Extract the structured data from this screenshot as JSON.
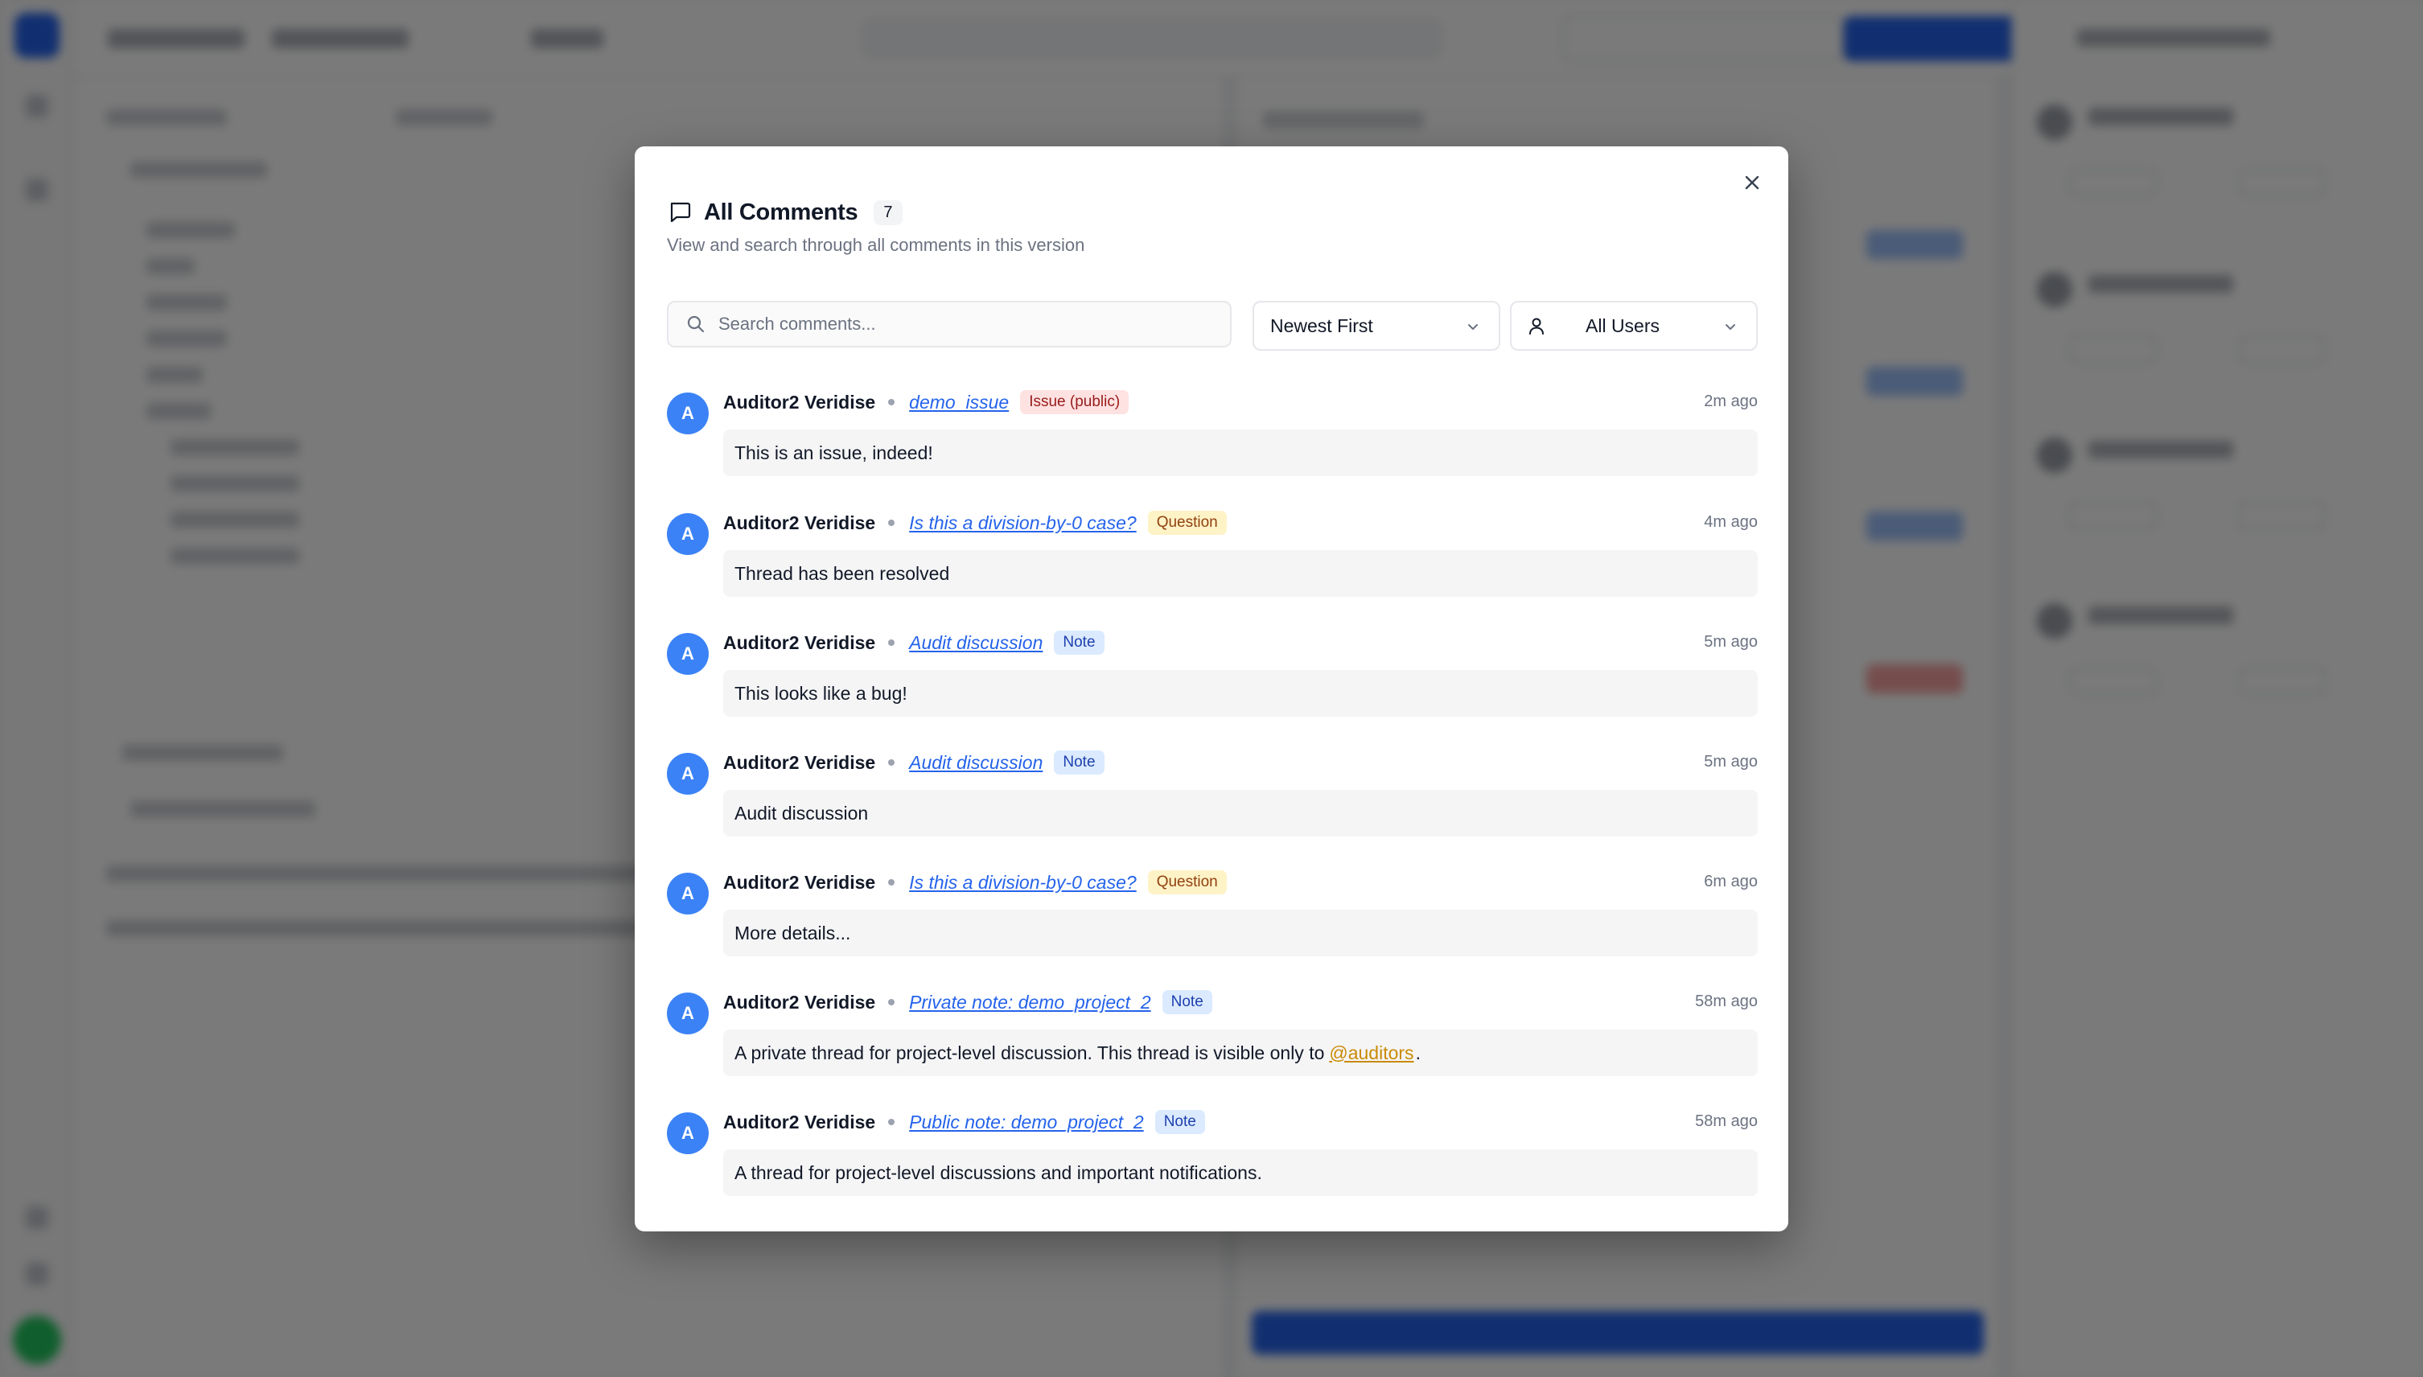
{
  "modal": {
    "title": "All Comments",
    "count": "7",
    "subtitle": "View and search through all comments in this version",
    "search_placeholder": "Search comments...",
    "sort_value": "Newest First",
    "user_filter_value": "All Users"
  },
  "icons": {
    "header": "chat-bubble-icon",
    "search": "search-icon",
    "user": "user-icon",
    "dropdown": "chevron-down-icon",
    "close": "close-icon"
  },
  "colors": {
    "accent": "#3b82f6",
    "link": "#2563eb",
    "issue_badge": "#fee2e2",
    "question_badge": "#fef3c7",
    "note_badge": "#dbeafe",
    "mention": "#ca8a04"
  },
  "comments": [
    {
      "initial": "A",
      "author": "Auditor2 Veridise",
      "thread": "demo_issue",
      "badge": "Issue (public)",
      "badge_type": "issue",
      "time": "2m ago",
      "body": "This is an issue, indeed!"
    },
    {
      "initial": "A",
      "author": "Auditor2 Veridise",
      "thread": "Is this a division-by-0 case?",
      "badge": "Question",
      "badge_type": "question",
      "time": "4m ago",
      "body": "Thread has been resolved"
    },
    {
      "initial": "A",
      "author": "Auditor2 Veridise",
      "thread": "Audit discussion",
      "badge": "Note",
      "badge_type": "note",
      "time": "5m ago",
      "body": "This looks like a bug!"
    },
    {
      "initial": "A",
      "author": "Auditor2 Veridise",
      "thread": "Audit discussion",
      "badge": "Note",
      "badge_type": "note",
      "time": "5m ago",
      "body": "Audit discussion"
    },
    {
      "initial": "A",
      "author": "Auditor2 Veridise",
      "thread": "Is this a division-by-0 case?",
      "badge": "Question",
      "badge_type": "question",
      "time": "6m ago",
      "body": "More details..."
    },
    {
      "initial": "A",
      "author": "Auditor2 Veridise",
      "thread": "Private note: demo_project_2",
      "badge": "Note",
      "badge_type": "note",
      "time": "58m ago",
      "body": "A private thread for project-level discussion. This thread is visible only to",
      "mention": "@auditors",
      "body_suffix": "."
    },
    {
      "initial": "A",
      "author": "Auditor2 Veridise",
      "thread": "Public note: demo_project_2",
      "badge": "Note",
      "badge_type": "note",
      "time": "58m ago",
      "body": "A thread for project-level discussions and important notifications."
    }
  ]
}
